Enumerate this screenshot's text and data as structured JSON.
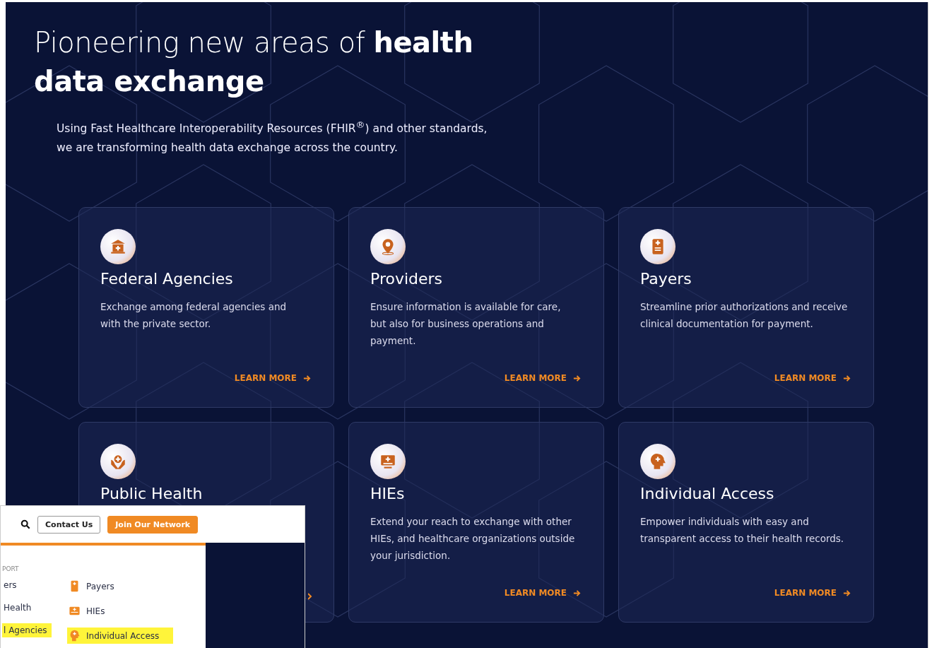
{
  "hero": {
    "title_light": "Pioneering new areas of",
    "title_bold_1": "health",
    "title_bold_2": "data exchange",
    "intro": "Using Fast Healthcare Interoperability Resources (FHIR$^{®}$) and other standards, we are transforming health data exchange across the country."
  },
  "cards": [
    {
      "kind": "building",
      "title": "Federal Agencies",
      "text": "Exchange among federal agencies and with the private sector.",
      "link": "LEARN MORE"
    },
    {
      "kind": "pin",
      "title": "Providers",
      "text": "Ensure information is available for care, but also for business operations and payment.",
      "link": "LEARN MORE"
    },
    {
      "kind": "document",
      "title": "Payers",
      "text": "Streamline prior authorizations and receive clinical documentation for payment.",
      "link": "LEARN MORE"
    },
    {
      "kind": "hands",
      "title": "Public Health"
    },
    {
      "kind": "screen",
      "title": "HIEs",
      "text": "Extend your reach to exchange with other HIEs, and healthcare organizations outside your jurisdiction.",
      "link": "LEARN MORE"
    },
    {
      "kind": "head",
      "title": "Individual Access",
      "text": "Empower individuals with easy and transparent access to their health records.",
      "link": "LEARN MORE"
    }
  ],
  "inset": {
    "buttons": [
      "Contact Us",
      "Join Our Network"
    ],
    "menu_heading": "PORT",
    "left_items": [
      {
        "label": "ers",
        "highlighted": false
      },
      {
        "label": "Health",
        "highlighted": false
      },
      {
        "label": "l Agencies",
        "highlighted": true
      }
    ],
    "right_items": [
      {
        "kind": "document",
        "label": "Payers",
        "highlighted": false
      },
      {
        "kind": "screen",
        "label": "HIEs",
        "highlighted": false
      },
      {
        "kind": "head",
        "label": "Individual Access",
        "highlighted": true
      }
    ]
  }
}
